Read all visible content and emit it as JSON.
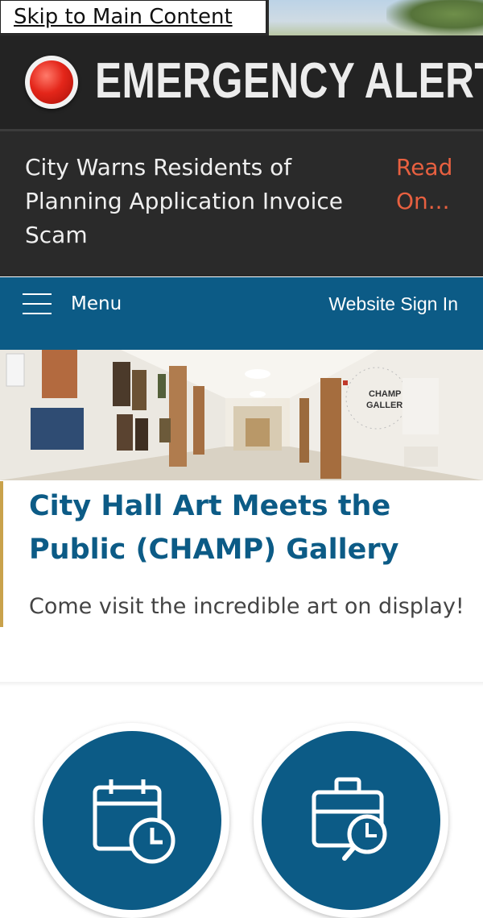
{
  "skip_link": "Skip to Main Content",
  "alert": {
    "title": "EMERGENCY ALERT",
    "message": "City Warns Residents of Planning Application Invoice Scam",
    "read_more": "Read On..."
  },
  "nav": {
    "menu_label": "Menu",
    "sign_in": "Website Sign In"
  },
  "feature": {
    "title": "City Hall Art Meets the Public (CHAMP) Gallery",
    "subtitle": "Come visit the incredible art on display!",
    "wall_sign_line1": "CHAMP",
    "wall_sign_line2": "GALLERY"
  },
  "quick_links": [
    {
      "icon": "calendar-clock-icon"
    },
    {
      "icon": "briefcase-search-icon"
    }
  ],
  "colors": {
    "primary": "#0c5b86",
    "alert_link": "#e86040",
    "accent_border": "#c9a24b",
    "alert_bg": "#232323"
  }
}
